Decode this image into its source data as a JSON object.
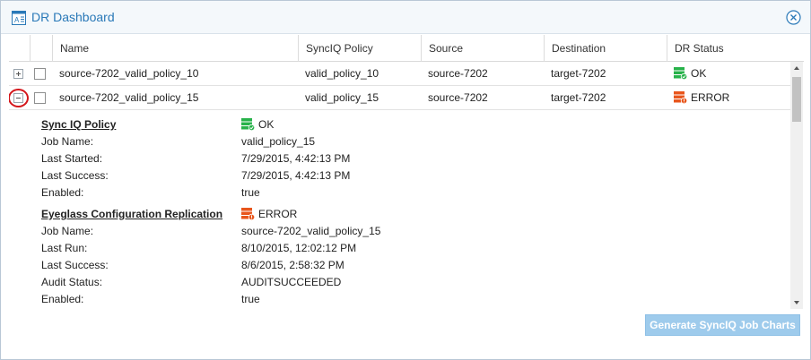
{
  "window": {
    "title": "DR Dashboard",
    "title_icon": "dashboard-icon",
    "close_icon": "close-circle-icon"
  },
  "grid": {
    "columns": [
      "",
      "",
      "Name",
      "SyncIQ Policy",
      "Source",
      "Destination",
      "DR Status"
    ],
    "rows": [
      {
        "expanded": false,
        "name": "source-7202_valid_policy_10",
        "synciq_policy": "valid_policy_10",
        "source": "source-7202",
        "destination": "target-7202",
        "dr_status": "OK"
      },
      {
        "expanded": true,
        "name": "source-7202_valid_policy_15",
        "synciq_policy": "valid_policy_15",
        "source": "source-7202",
        "destination": "target-7202",
        "dr_status": "ERROR"
      }
    ]
  },
  "detail": {
    "synciq": {
      "title": "Sync IQ Policy",
      "status": "OK",
      "fields": [
        {
          "label": "Job Name:",
          "value": "valid_policy_15"
        },
        {
          "label": "Last Started:",
          "value": "7/29/2015, 4:42:13 PM"
        },
        {
          "label": "Last Success:",
          "value": "7/29/2015, 4:42:13 PM"
        },
        {
          "label": "Enabled:",
          "value": "true"
        }
      ]
    },
    "eyeglass": {
      "title": "Eyeglass Configuration Replication",
      "status": "ERROR",
      "fields": [
        {
          "label": "Job Name:",
          "value": "source-7202_valid_policy_15"
        },
        {
          "label": "Last Run:",
          "value": "8/10/2015, 12:02:12 PM"
        },
        {
          "label": "Last Success:",
          "value": "8/6/2015, 2:58:32 PM"
        },
        {
          "label": "Audit Status:",
          "value": "AUDITSUCCEEDED"
        },
        {
          "label": "Enabled:",
          "value": "true"
        }
      ]
    }
  },
  "footer": {
    "generate_button": "Generate SyncIQ Job Charts"
  },
  "colors": {
    "title": "#2a79b8",
    "ok": "#27b24a",
    "error": "#e8561c",
    "annotation_circle": "#d4161b",
    "button_disabled": "#9ecbec"
  }
}
